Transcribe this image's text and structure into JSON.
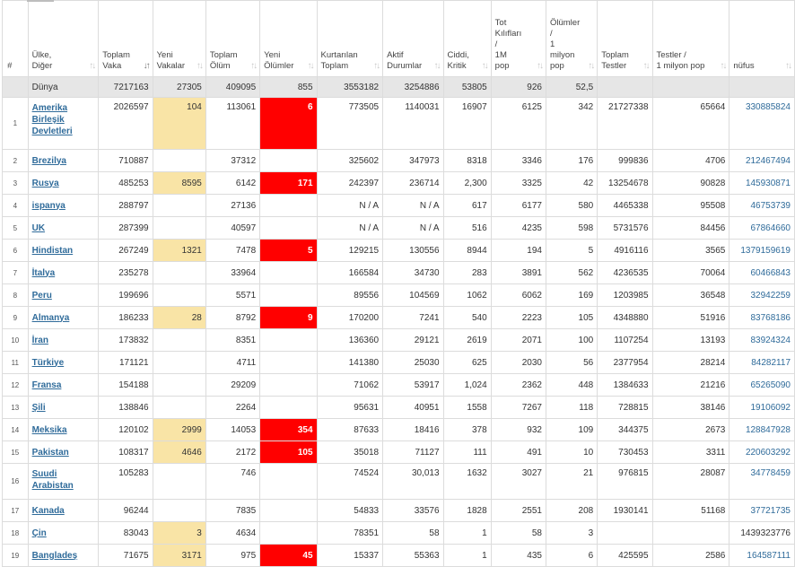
{
  "columns": [
    {
      "label": "#",
      "sort": ""
    },
    {
      "label": "Ülke,\nDiğer",
      "sort": "↑↓"
    },
    {
      "label": "Toplam\nVaka",
      "sort": "↓↑"
    },
    {
      "label": "Yeni\nVakalar",
      "sort": "↑↓"
    },
    {
      "label": "Toplam\nÖlüm",
      "sort": "↑↓"
    },
    {
      "label": "Yeni\nÖlümler",
      "sort": "↑↓"
    },
    {
      "label": "Kurtarılan\nToplam",
      "sort": "↑↓"
    },
    {
      "label": "Aktif\nDurumlar",
      "sort": "↑↓"
    },
    {
      "label": "Ciddi,\nKritik",
      "sort": "↑↓"
    },
    {
      "label": "Tot\nKılıfları\n/\n1M\npop",
      "sort": "↑↓"
    },
    {
      "label": "Ölümler\n/\n1\nmilyon\npop",
      "sort": "↑↓"
    },
    {
      "label": "Toplam\nTestler",
      "sort": "↑↓"
    },
    {
      "label": "Testler /\n1 milyon pop",
      "sort": "↑↓"
    },
    {
      "label": "nüfus",
      "sort": "↑↓"
    }
  ],
  "world": [
    "",
    "Dünya",
    "7217163",
    "27305",
    "409095",
    "855",
    "3553182",
    "3254886",
    "53805",
    "926",
    "52,5",
    "",
    "",
    ""
  ],
  "rows": [
    [
      "1",
      "Amerika Birleşik Devletleri",
      "2026597",
      "104",
      "113061",
      "6",
      "773505",
      "1140031",
      "16907",
      "6125",
      "342",
      "21727338",
      "65664",
      "330885824"
    ],
    [
      "2",
      "Brezilya",
      "710887",
      "",
      "37312",
      "",
      "325602",
      "347973",
      "8318",
      "3346",
      "176",
      "999836",
      "4706",
      "212467494"
    ],
    [
      "3",
      "Rusya",
      "485253",
      "8595",
      "6142",
      "171",
      "242397",
      "236714",
      "2,300",
      "3325",
      "42",
      "13254678",
      "90828",
      "145930871"
    ],
    [
      "4",
      "ispanya",
      "288797",
      "",
      "27136",
      "",
      "N / A",
      "N / A",
      "617",
      "6177",
      "580",
      "4465338",
      "95508",
      "46753739"
    ],
    [
      "5",
      "UK",
      "287399",
      "",
      "40597",
      "",
      "N / A",
      "N / A",
      "516",
      "4235",
      "598",
      "5731576",
      "84456",
      "67864660"
    ],
    [
      "6",
      "Hindistan",
      "267249",
      "1321",
      "7478",
      "5",
      "129215",
      "130556",
      "8944",
      "194",
      "5",
      "4916116",
      "3565",
      "1379159619"
    ],
    [
      "7",
      "İtalya",
      "235278",
      "",
      "33964",
      "",
      "166584",
      "34730",
      "283",
      "3891",
      "562",
      "4236535",
      "70064",
      "60466843"
    ],
    [
      "8",
      "Peru",
      "199696",
      "",
      "5571",
      "",
      "89556",
      "104569",
      "1062",
      "6062",
      "169",
      "1203985",
      "36548",
      "32942259"
    ],
    [
      "9",
      "Almanya",
      "186233",
      "28",
      "8792",
      "9",
      "170200",
      "7241",
      "540",
      "2223",
      "105",
      "4348880",
      "51916",
      "83768186"
    ],
    [
      "10",
      "İran",
      "173832",
      "",
      "8351",
      "",
      "136360",
      "29121",
      "2619",
      "2071",
      "100",
      "1107254",
      "13193",
      "83924324"
    ],
    [
      "11",
      "Türkiye",
      "171121",
      "",
      "4711",
      "",
      "141380",
      "25030",
      "625",
      "2030",
      "56",
      "2377954",
      "28214",
      "84282117"
    ],
    [
      "12",
      "Fransa",
      "154188",
      "",
      "29209",
      "",
      "71062",
      "53917",
      "1,024",
      "2362",
      "448",
      "1384633",
      "21216",
      "65265090"
    ],
    [
      "13",
      "Şili",
      "138846",
      "",
      "2264",
      "",
      "95631",
      "40951",
      "1558",
      "7267",
      "118",
      "728815",
      "38146",
      "19106092"
    ],
    [
      "14",
      "Meksika",
      "120102",
      "2999",
      "14053",
      "354",
      "87633",
      "18416",
      "378",
      "932",
      "109",
      "344375",
      "2673",
      "128847928"
    ],
    [
      "15",
      "Pakistan",
      "108317",
      "4646",
      "2172",
      "105",
      "35018",
      "71127",
      "111",
      "491",
      "10",
      "730453",
      "3311",
      "220603292"
    ],
    [
      "16",
      "Suudi Arabistan",
      "105283",
      "",
      "746",
      "",
      "74524",
      "30,013",
      "1632",
      "3027",
      "21",
      "976815",
      "28087",
      "34778459"
    ],
    [
      "17",
      "Kanada",
      "96244",
      "",
      "7835",
      "",
      "54833",
      "33576",
      "1828",
      "2551",
      "208",
      "1930141",
      "51168",
      "37721735"
    ],
    [
      "18",
      "Çin",
      "83043",
      "3",
      "4634",
      "",
      "78351",
      "58",
      "1",
      "58",
      "3",
      "",
      "",
      "1439323776"
    ],
    [
      "19",
      "Bangladeş",
      "71675",
      "3171",
      "975",
      "45",
      "15337",
      "55363",
      "1",
      "435",
      "6",
      "425595",
      "2586",
      "164587111"
    ]
  ],
  "colors": {
    "new_cases": "#f9e4a6",
    "new_deaths": "#ff0000",
    "link": "#2f6b9a",
    "world_row": "#e6e6e6"
  }
}
